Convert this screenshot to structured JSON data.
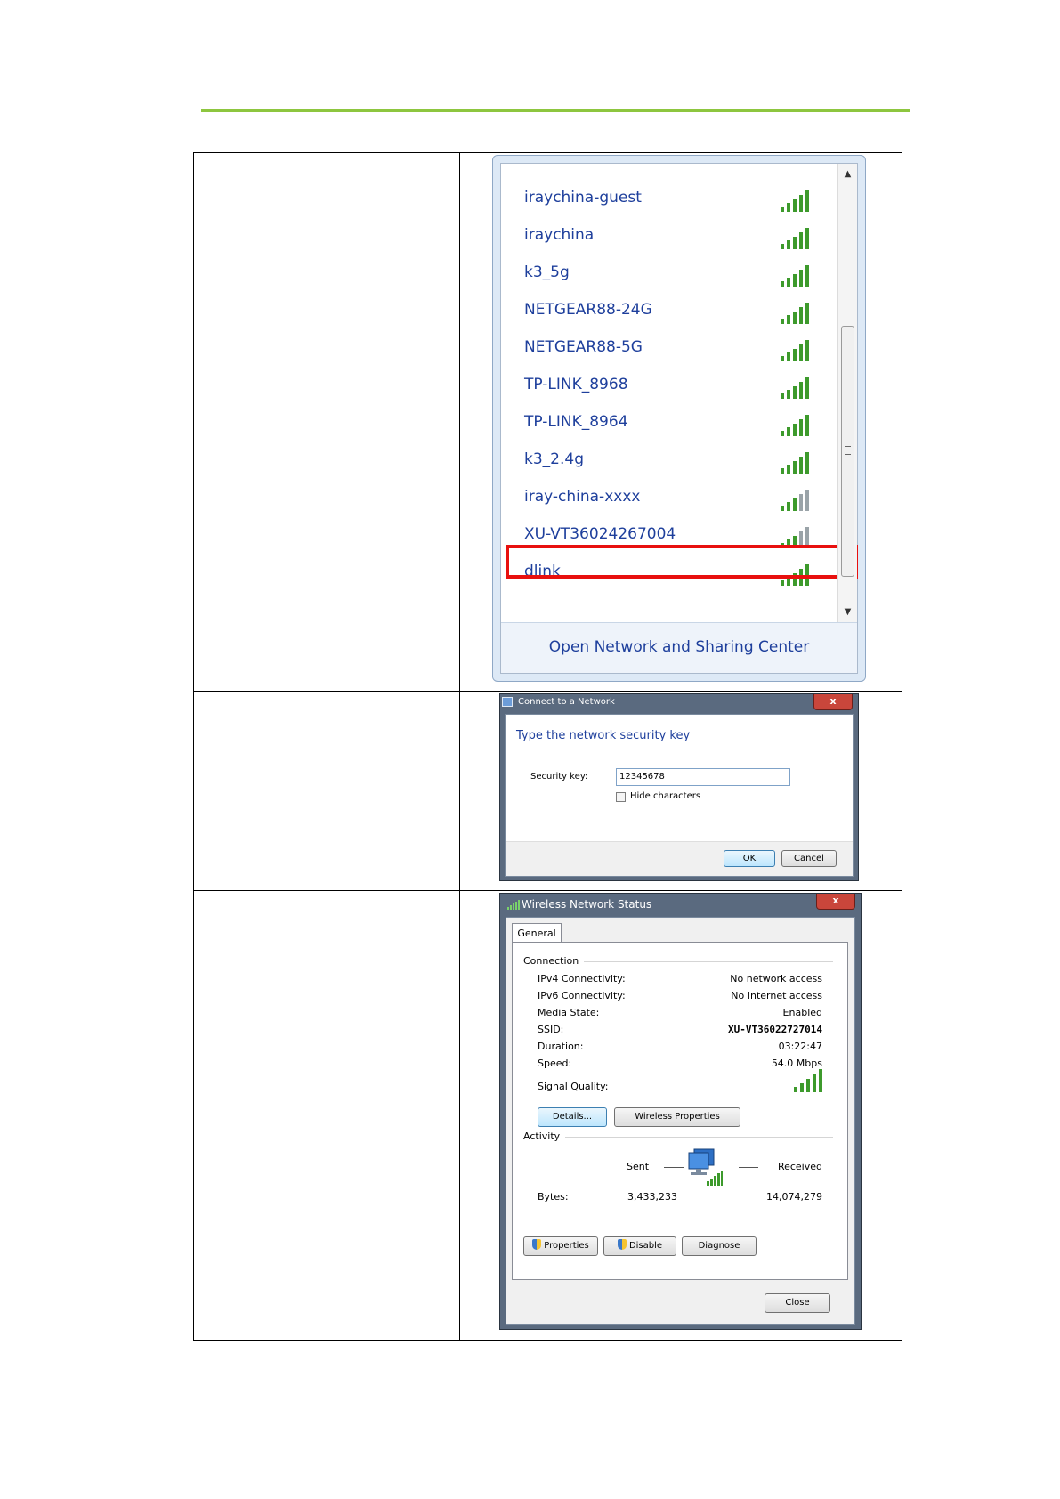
{
  "wifi_list": {
    "networks": [
      {
        "name": "iraychina-guest",
        "signal": "strong"
      },
      {
        "name": "iraychina",
        "signal": "strong"
      },
      {
        "name": "k3_5g",
        "signal": "strong"
      },
      {
        "name": "NETGEAR88-24G",
        "signal": "strong"
      },
      {
        "name": "NETGEAR88-5G",
        "signal": "strong"
      },
      {
        "name": "TP-LINK_8968",
        "signal": "strong"
      },
      {
        "name": "TP-LINK_8964",
        "signal": "strong"
      },
      {
        "name": "k3_2.4g",
        "signal": "strong"
      },
      {
        "name": "iray-china-xxxx",
        "signal": "medium"
      },
      {
        "name": "XU-VT36024267004",
        "signal": "medium",
        "highlighted": true
      },
      {
        "name": "dlink",
        "signal": "strong"
      }
    ],
    "footer_link": "Open Network and Sharing Center",
    "highlight_color": "#e8100e",
    "link_color": "#1e3f9c"
  },
  "connect_dialog": {
    "title": "Connect to a Network",
    "heading": "Type the network security key",
    "security_key_label": "Security key:",
    "security_key_value": "12345678",
    "hide_characters_label": "Hide characters",
    "ok_label": "OK",
    "cancel_label": "Cancel",
    "close_glyph": "x"
  },
  "status_dialog": {
    "title": "Wireless Network Status",
    "tab": "General",
    "connection_label": "Connection",
    "rows": [
      {
        "label": "IPv4 Connectivity:",
        "value": "No network access"
      },
      {
        "label": "IPv6 Connectivity:",
        "value": "No Internet access"
      },
      {
        "label": "Media State:",
        "value": "Enabled"
      },
      {
        "label": "SSID:",
        "value": "XU-VT36022727014"
      },
      {
        "label": "Duration:",
        "value": "03:22:47"
      },
      {
        "label": "Speed:",
        "value": "54.0 Mbps"
      }
    ],
    "signal_quality_label": "Signal Quality:",
    "details_button": "Details...",
    "wireless_properties_button": "Wireless Properties",
    "activity_label": "Activity",
    "sent_label": "Sent",
    "received_label": "Received",
    "bytes_label": "Bytes:",
    "bytes_sent": "3,433,233",
    "bytes_received": "14,074,279",
    "properties_button": "Properties",
    "disable_button": "Disable",
    "diagnose_button": "Diagnose",
    "close_button": "Close"
  },
  "colors": {
    "accent_line": "#8dc63f",
    "signal_green": "#3d9a2c"
  }
}
